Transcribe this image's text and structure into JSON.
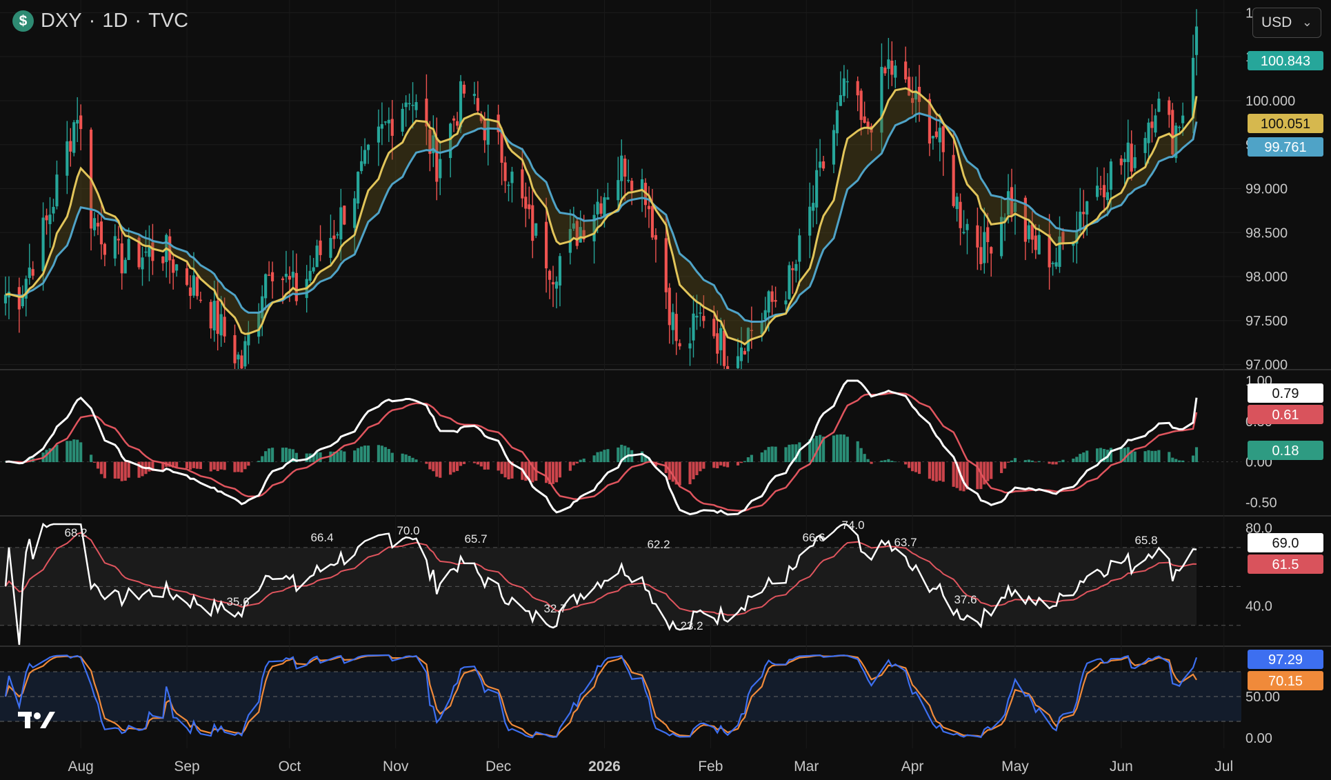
{
  "header": {
    "symbol": "DXY",
    "separator": "·",
    "interval": "1D",
    "exchange": "TVC",
    "currency_select": "USD",
    "currency_symbol_icon": "$"
  },
  "colors": {
    "background": "#0e0e0e",
    "up_candle": "#26a69a",
    "down_candle": "#ef5350",
    "ema_fast": "#e2c55a",
    "ema_slow": "#4fa3c7",
    "macd_line": "#ffffff",
    "signal_line": "#e0555e",
    "stoch_k": "#3d6ff0",
    "stoch_d": "#f08a3a"
  },
  "axis": {
    "x_labels": [
      "Aug",
      "Sep",
      "Oct",
      "Nov",
      "Dec",
      "2026",
      "Feb",
      "Mar",
      "Apr",
      "May",
      "Jun",
      "Jul"
    ],
    "price_ticks": [
      "101.000",
      "100.500",
      "100.000",
      "99.500",
      "99.000",
      "98.500",
      "98.000",
      "97.500",
      "97.000"
    ],
    "macd_ticks": [
      "1.00",
      "0.50",
      "0.00",
      "-0.50"
    ],
    "rsi_ticks": [
      "80.0",
      "40.0"
    ],
    "stoch_ticks": [
      "50.00",
      "0.00"
    ]
  },
  "badges": {
    "last_price": "100.843",
    "ema_fast": "100.051",
    "ema_slow": "99.761",
    "macd": "0.79",
    "signal": "0.61",
    "histogram": "0.18",
    "rsi": "69.0",
    "rsi_ma": "61.5",
    "stoch_k": "97.29",
    "stoch_d": "70.15"
  },
  "rsi_annotations": [
    "68.2",
    "35.6",
    "66.4",
    "70.0",
    "65.7",
    "32.7",
    "62.2",
    "23.2",
    "66.6",
    "74.0",
    "63.7",
    "37.6",
    "65.8"
  ],
  "chart_data": {
    "type": "candlestick",
    "title": "DXY · 1D · TVC",
    "price_range": [
      97.0,
      101.0
    ],
    "close_anchors": [
      {
        "date": "2025-07-14",
        "close": 97.8
      },
      {
        "date": "2025-07-22",
        "close": 98.6
      },
      {
        "date": "2025-07-31",
        "close": 99.9
      },
      {
        "date": "2025-08-04",
        "close": 98.7
      },
      {
        "date": "2025-08-12",
        "close": 98.2
      },
      {
        "date": "2025-08-25",
        "close": 98.3
      },
      {
        "date": "2025-09-05",
        "close": 97.8
      },
      {
        "date": "2025-09-17",
        "close": 97.0
      },
      {
        "date": "2025-09-25",
        "close": 98.2
      },
      {
        "date": "2025-10-03",
        "close": 97.8
      },
      {
        "date": "2025-10-15",
        "close": 98.6
      },
      {
        "date": "2025-10-29",
        "close": 99.7
      },
      {
        "date": "2025-11-05",
        "close": 100.1
      },
      {
        "date": "2025-11-13",
        "close": 99.3
      },
      {
        "date": "2025-11-21",
        "close": 100.1
      },
      {
        "date": "2025-12-02",
        "close": 99.4
      },
      {
        "date": "2025-12-10",
        "close": 98.6
      },
      {
        "date": "2025-12-17",
        "close": 98.1
      },
      {
        "date": "2025-12-29",
        "close": 98.8
      },
      {
        "date": "2026-01-07",
        "close": 99.3
      },
      {
        "date": "2026-01-13",
        "close": 99.0
      },
      {
        "date": "2026-01-23",
        "close": 97.1
      },
      {
        "date": "2026-01-30",
        "close": 97.6
      },
      {
        "date": "2026-02-06",
        "close": 97.1
      },
      {
        "date": "2026-02-17",
        "close": 97.6
      },
      {
        "date": "2026-02-25",
        "close": 98.0
      },
      {
        "date": "2026-03-04",
        "close": 99.0
      },
      {
        "date": "2026-03-13",
        "close": 100.2
      },
      {
        "date": "2026-03-18",
        "close": 99.6
      },
      {
        "date": "2026-03-25",
        "close": 100.4
      },
      {
        "date": "2026-04-01",
        "close": 100.0
      },
      {
        "date": "2026-04-08",
        "close": 99.6
      },
      {
        "date": "2026-04-15",
        "close": 98.7
      },
      {
        "date": "2026-04-22",
        "close": 98.3
      },
      {
        "date": "2026-04-29",
        "close": 98.9
      },
      {
        "date": "2026-05-05",
        "close": 98.4
      },
      {
        "date": "2026-05-13",
        "close": 98.2
      },
      {
        "date": "2026-05-22",
        "close": 98.9
      },
      {
        "date": "2026-05-29",
        "close": 99.2
      },
      {
        "date": "2026-06-05",
        "close": 99.4
      },
      {
        "date": "2026-06-11",
        "close": 100.0
      },
      {
        "date": "2026-06-16",
        "close": 99.6
      },
      {
        "date": "2026-06-19",
        "close": 99.9
      },
      {
        "date": "2026-06-23",
        "close": 100.843
      }
    ],
    "ema_fast_last": 100.051,
    "ema_slow_last": 99.761,
    "macd_range": [
      -0.65,
      1.0
    ],
    "rsi_levels": [
      70,
      50,
      30
    ],
    "stoch_levels": [
      80,
      50,
      20
    ]
  }
}
